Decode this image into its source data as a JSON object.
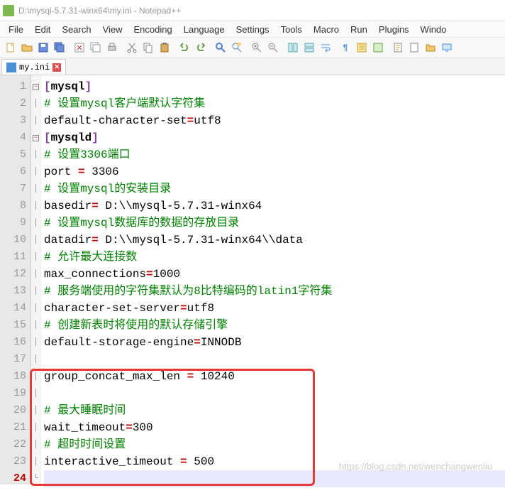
{
  "title": "D:\\mysql-5.7.31-winx64\\my.ini - Notepad++",
  "menus": [
    "File",
    "Edit",
    "Search",
    "View",
    "Encoding",
    "Language",
    "Settings",
    "Tools",
    "Macro",
    "Run",
    "Plugins",
    "Windo"
  ],
  "tab": {
    "name": "my.ini"
  },
  "lines": [
    {
      "n": 1,
      "fold": "minus",
      "type": "section",
      "bracket_open": "[",
      "name": "mysql",
      "bracket_close": "]"
    },
    {
      "n": 2,
      "fold": "pipe",
      "type": "comment",
      "text": "# 设置mysql客户端默认字符集"
    },
    {
      "n": 3,
      "fold": "pipe",
      "type": "kv",
      "key": "default-character-set",
      "eq": "=",
      "val": "utf8"
    },
    {
      "n": 4,
      "fold": "minus",
      "type": "section",
      "bracket_open": "[",
      "name": "mysqld",
      "bracket_close": "]"
    },
    {
      "n": 5,
      "fold": "pipe",
      "type": "comment",
      "text": "# 设置3306端口"
    },
    {
      "n": 6,
      "fold": "pipe",
      "type": "kv",
      "key": "port ",
      "eq": "=",
      "val": " 3306"
    },
    {
      "n": 7,
      "fold": "pipe",
      "type": "comment",
      "text": "# 设置mysql的安装目录"
    },
    {
      "n": 8,
      "fold": "pipe",
      "type": "kv",
      "key": "basedir",
      "eq": "=",
      "val": " D:\\\\mysql-5.7.31-winx64"
    },
    {
      "n": 9,
      "fold": "pipe",
      "type": "comment",
      "text": "# 设置mysql数据库的数据的存放目录"
    },
    {
      "n": 10,
      "fold": "pipe",
      "type": "kv",
      "key": "datadir",
      "eq": "=",
      "val": " D:\\\\mysql-5.7.31-winx64\\\\data"
    },
    {
      "n": 11,
      "fold": "pipe",
      "type": "comment",
      "text": "# 允许最大连接数"
    },
    {
      "n": 12,
      "fold": "pipe",
      "type": "kv",
      "key": "max_connections",
      "eq": "=",
      "val": "1000"
    },
    {
      "n": 13,
      "fold": "pipe",
      "type": "comment",
      "text": "# 服务端使用的字符集默认为8比特编码的latin1字符集"
    },
    {
      "n": 14,
      "fold": "pipe",
      "type": "kv",
      "key": "character-set-server",
      "eq": "=",
      "val": "utf8"
    },
    {
      "n": 15,
      "fold": "pipe",
      "type": "comment",
      "text": "# 创建新表时将使用的默认存储引擎"
    },
    {
      "n": 16,
      "fold": "pipe",
      "type": "kv",
      "key": "default-storage-engine",
      "eq": "=",
      "val": "INNODB"
    },
    {
      "n": 17,
      "fold": "pipe",
      "type": "blank",
      "text": ""
    },
    {
      "n": 18,
      "fold": "pipe",
      "type": "kv",
      "key": "group_concat_max_len ",
      "eq": "=",
      "val": " 10240"
    },
    {
      "n": 19,
      "fold": "pipe",
      "type": "blank",
      "text": ""
    },
    {
      "n": 20,
      "fold": "pipe",
      "type": "comment",
      "text": "# 最大睡眠时间"
    },
    {
      "n": 21,
      "fold": "pipe",
      "type": "kv",
      "key": "wait_timeout",
      "eq": "=",
      "val": "300"
    },
    {
      "n": 22,
      "fold": "pipe",
      "type": "comment",
      "text": "# 超时时间设置"
    },
    {
      "n": 23,
      "fold": "pipe",
      "type": "kv",
      "key": "interactive_timeout ",
      "eq": "=",
      "val": " 500"
    },
    {
      "n": 24,
      "fold": "end",
      "type": "blank",
      "text": "",
      "current": true
    }
  ],
  "watermark": "https://blog.csdn.net/wenchangwenliu"
}
